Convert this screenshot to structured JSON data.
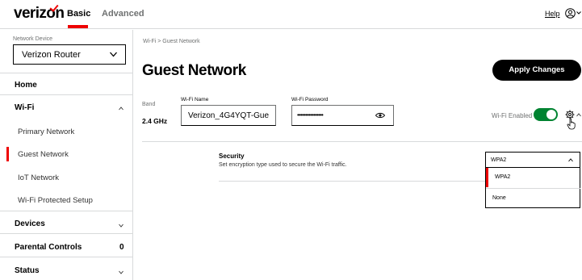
{
  "header": {
    "brand": "verizon",
    "tabs": [
      {
        "label": "Basic",
        "active": true
      },
      {
        "label": "Advanced",
        "active": false
      }
    ],
    "help_label": "Help",
    "accent_color": "#ee0000"
  },
  "sidebar": {
    "network_device_label": "Network Device",
    "network_device_value": "Verizon Router",
    "items": [
      {
        "label": "Home"
      },
      {
        "label": "Wi-Fi"
      },
      {
        "label": "Primary Network"
      },
      {
        "label": "Guest Network",
        "active": true
      },
      {
        "label": "IoT Network"
      },
      {
        "label": "Wi-Fi Protected Setup"
      },
      {
        "label": "Devices"
      },
      {
        "label": "Parental Controls",
        "count": "0"
      },
      {
        "label": "Status"
      }
    ]
  },
  "main": {
    "breadcrumb": "Wi-Fi  >  Guest Network",
    "title": "Guest Network",
    "apply_label": "Apply Changes",
    "band_label": "Band",
    "band_value": "2.4 GHz",
    "wifi_name_label": "Wi-Fi Name",
    "wifi_name_value": "Verizon_4G4YQT-Guest",
    "wifi_password_label": "Wi-Fi Password",
    "wifi_password_masked": "••••••••••••••••",
    "wifi_enabled_label": "Wi-Fi Enabled",
    "wifi_enabled": true,
    "toggle_color": "#008331",
    "security": {
      "title": "Security",
      "description": "Set encryption type used to secure the Wi-Fi traffic.",
      "selected": "WPA2",
      "options": [
        "WPA2",
        "None"
      ]
    }
  }
}
